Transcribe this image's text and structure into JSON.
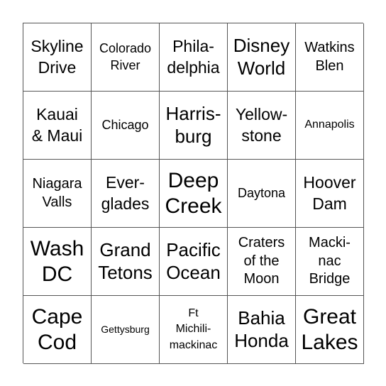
{
  "board": {
    "rows": [
      [
        {
          "text": "Skyline\nDrive",
          "size": "s-m"
        },
        {
          "text": "Colorado\nRiver",
          "size": "s-s"
        },
        {
          "text": "Phila-\ndelphia",
          "size": "s-m"
        },
        {
          "text": "Disney\nWorld",
          "size": "s-l"
        },
        {
          "text": "Watkins\nBlen",
          "size": "s-ms"
        }
      ],
      [
        {
          "text": "Kauai\n& Maui",
          "size": "s-m"
        },
        {
          "text": "Chicago",
          "size": "s-s"
        },
        {
          "text": "Harris-\nburg",
          "size": "s-l"
        },
        {
          "text": "Yellow-\nstone",
          "size": "s-m"
        },
        {
          "text": "Annapolis",
          "size": "s-xs"
        }
      ],
      [
        {
          "text": "Niagara\nValls",
          "size": "s-ms"
        },
        {
          "text": "Ever-\nglades",
          "size": "s-m"
        },
        {
          "text": "Deep\nCreek",
          "size": "s-xl"
        },
        {
          "text": "Daytona",
          "size": "s-s"
        },
        {
          "text": "Hoover\nDam",
          "size": "s-m"
        }
      ],
      [
        {
          "text": "Wash\nDC",
          "size": "s-xl"
        },
        {
          "text": "Grand\nTetons",
          "size": "s-l"
        },
        {
          "text": "Pacific\nOcean",
          "size": "s-l"
        },
        {
          "text": "Craters\nof the\nMoon",
          "size": "s-ms"
        },
        {
          "text": "Macki-\nnac\nBridge",
          "size": "s-ms"
        }
      ],
      [
        {
          "text": "Cape\nCod",
          "size": "s-xl"
        },
        {
          "text": "Gettysburg",
          "size": "s-xxs"
        },
        {
          "text": "Ft\nMichili-\nmackinac",
          "size": "s-xs"
        },
        {
          "text": "Bahia\nHonda",
          "size": "s-l"
        },
        {
          "text": "Great\nLakes",
          "size": "s-xl"
        }
      ]
    ]
  }
}
